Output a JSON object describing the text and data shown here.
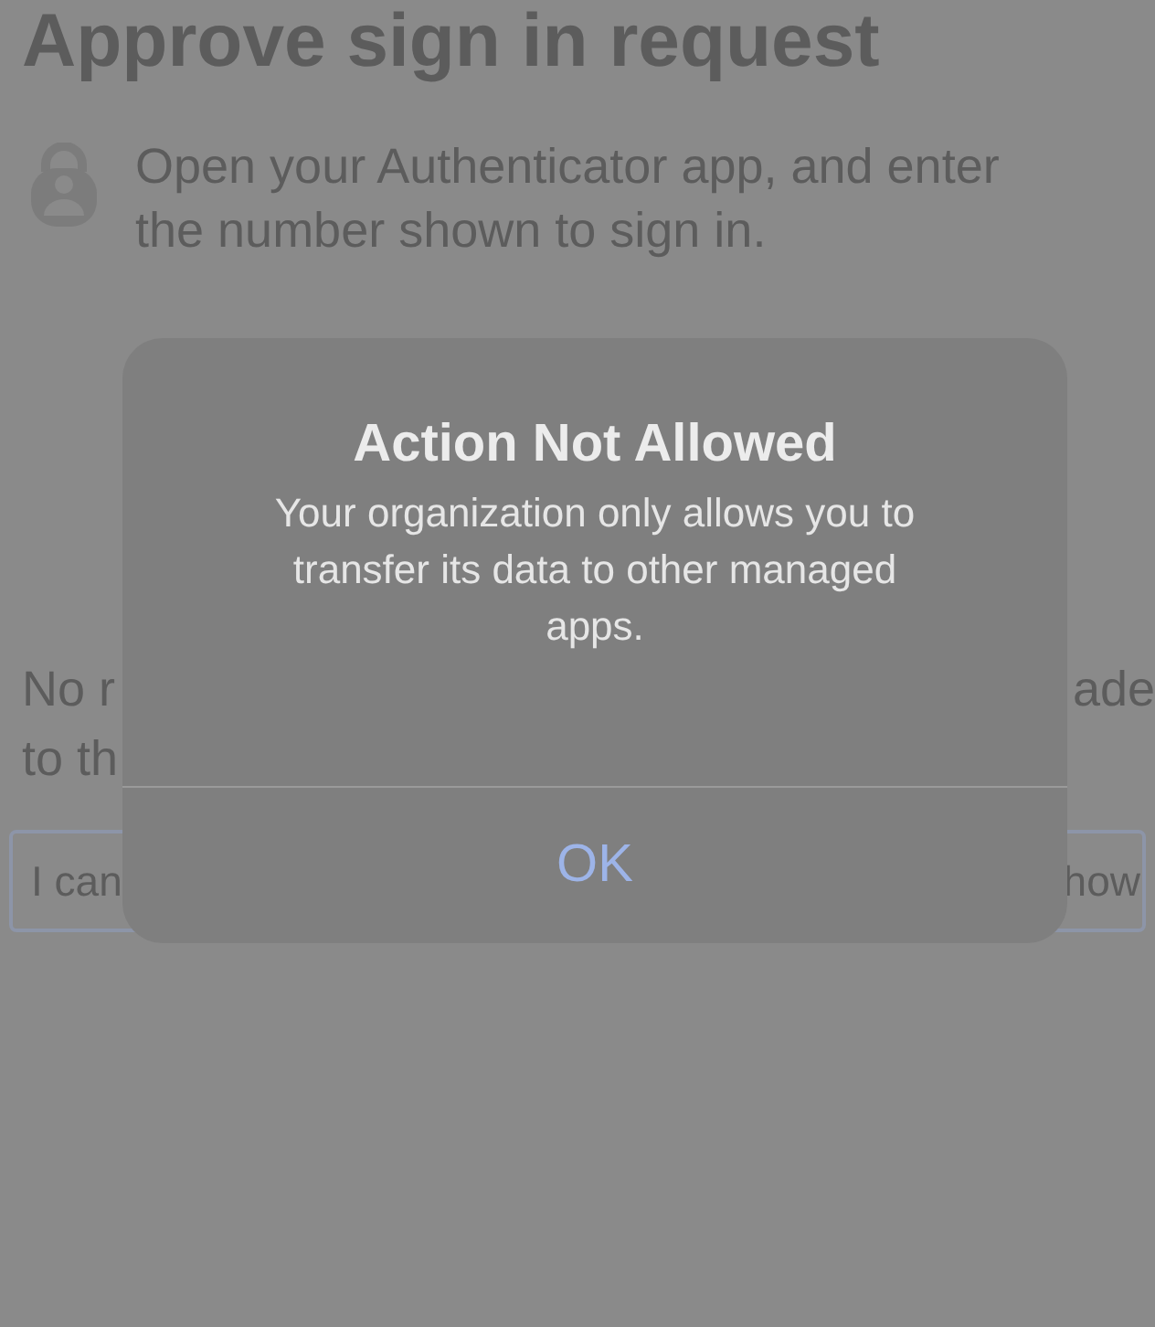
{
  "page": {
    "title": "Approve sign in request",
    "instruction": [
      "Open your Authenticator app, and enter",
      "the number shown to sign in."
    ],
    "notice": [
      {
        "left": "No r",
        "right": "ade"
      },
      {
        "left": "to th"
      }
    ],
    "link_button": {
      "left": "I can",
      "right": "how"
    }
  },
  "alert": {
    "title": "Action Not Allowed",
    "message": [
      "Your organization only allows you to",
      "transfer its data to other managed",
      "apps."
    ],
    "buttons": [
      "OK"
    ]
  }
}
